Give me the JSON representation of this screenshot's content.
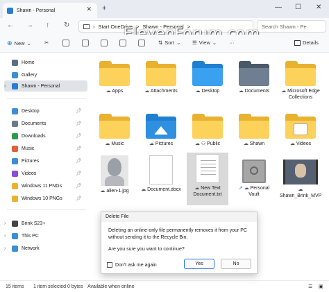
{
  "window": {
    "tab_title": "Shawn - Personal",
    "minimize": "—",
    "maximize": "☐",
    "close": "✕",
    "new_tab": "+"
  },
  "address": {
    "breadcrumbs": [
      "Start OneDrive",
      ">",
      "Shawn - Personal",
      ">"
    ],
    "search_placeholder": "Search Shawn - Pe"
  },
  "watermark": "ElevenForum.com",
  "toolbar": {
    "new_label": "New",
    "sort_label": "Sort",
    "view_label": "View",
    "more_label": "···",
    "details_label": "Details"
  },
  "sidebar": {
    "top": [
      {
        "label": "Home",
        "icon": "home-icon",
        "color": "#5a6f85"
      },
      {
        "label": "Gallery",
        "icon": "gallery-icon",
        "color": "#3a8fd6"
      },
      {
        "label": "Shawn - Personal",
        "icon": "onedrive-icon",
        "color": "#2b7cd3"
      }
    ],
    "quick": [
      {
        "label": "Desktop",
        "icon": "desktop-icon",
        "color": "#3a8fd6"
      },
      {
        "label": "Documents",
        "icon": "documents-icon",
        "color": "#6c7a8a"
      },
      {
        "label": "Downloads",
        "icon": "downloads-icon",
        "color": "#2e9a4f"
      },
      {
        "label": "Music",
        "icon": "music-icon",
        "color": "#e0613a"
      },
      {
        "label": "Pictures",
        "icon": "pictures-icon",
        "color": "#3a8fd6"
      },
      {
        "label": "Videos",
        "icon": "videos-icon",
        "color": "#8a4fd0"
      },
      {
        "label": "Windows 11 PNGs",
        "icon": "folder-icon",
        "color": "#e8b130"
      },
      {
        "label": "Windows 10 PNGs",
        "icon": "folder-icon",
        "color": "#e8b130"
      }
    ],
    "bottom": [
      {
        "label": "Brink S23+",
        "icon": "phone-icon",
        "color": "#444"
      },
      {
        "label": "This PC",
        "icon": "pc-icon",
        "color": "#3a8fd6"
      },
      {
        "label": "Network",
        "icon": "network-icon",
        "color": "#3a8fd6"
      }
    ]
  },
  "items": [
    {
      "label": "Apps",
      "kind": "folder",
      "emblem": ""
    },
    {
      "label": "Attachments",
      "kind": "folder",
      "emblem": ""
    },
    {
      "label": "Desktop",
      "kind": "folder",
      "emblem": "#1f7fd1"
    },
    {
      "label": "Documents",
      "kind": "folder",
      "emblem": "#5d6b7b"
    },
    {
      "label": "Microsoft Edge Collections",
      "kind": "folder",
      "emblem": ""
    },
    {
      "label": "Music",
      "kind": "folder",
      "emblem": ""
    },
    {
      "label": "Pictures",
      "kind": "folder",
      "emblem": "#2f8fe0"
    },
    {
      "label": "Public",
      "kind": "folder",
      "emblem": ""
    },
    {
      "label": "Shawn",
      "kind": "folder",
      "emblem": ""
    },
    {
      "label": "Videos",
      "kind": "folder",
      "emblem": "#ffffff"
    },
    {
      "label": "alien-1.jpg",
      "kind": "image",
      "emblem": "#9aa0a6"
    },
    {
      "label": "Document.docx",
      "kind": "doc",
      "emblem": ""
    },
    {
      "label": "New Text Document.txt",
      "kind": "doc",
      "emblem": ""
    },
    {
      "label": "Personal Vault",
      "kind": "vault",
      "emblem": "#9a9a9a"
    },
    {
      "label": "Shawn_Brink_MVP",
      "kind": "image",
      "emblem": "#556070"
    }
  ],
  "status": {
    "count": "15 items",
    "selected": "1 item selected  0 bytes",
    "availability": "Available when online"
  },
  "dialog": {
    "title": "Delete File",
    "message": "Deleting an online-only file permanently removes it from your PC without sending it to the Recycle Bin.",
    "question": "Are you sure you want to continue?",
    "checkbox_label": "Don't ask me again",
    "yes_label": "Yes",
    "no_label": "No"
  }
}
